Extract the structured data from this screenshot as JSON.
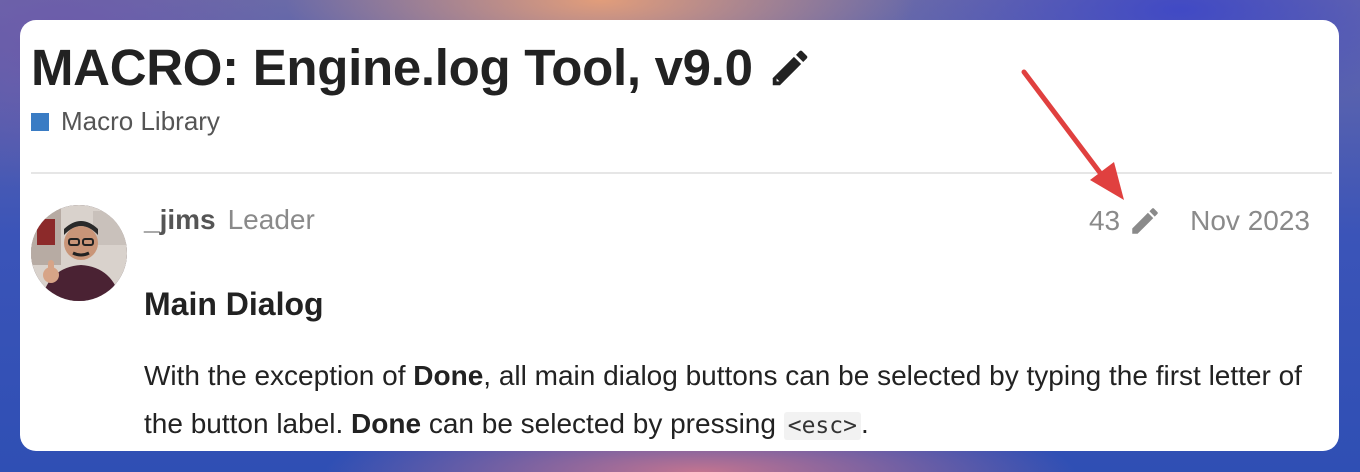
{
  "topic": {
    "title": "MACRO: Engine.log Tool, v9.0",
    "category": "Macro Library",
    "category_color": "#3a7cc4"
  },
  "post": {
    "username": "_jims",
    "user_title": "Leader",
    "edit_count": "43",
    "date": "Nov 2023",
    "heading": "Main Dialog",
    "body": {
      "p1_a": "With the exception of ",
      "p1_bold1": "Done",
      "p1_b": ", all main dialog buttons can be selected by typing the first letter of the button label. ",
      "p1_bold2": "Done",
      "p1_c": " can be selected by pressing ",
      "p1_code": "<esc>",
      "p1_d": "."
    }
  },
  "icons": {
    "title_edit": "pencil-icon",
    "post_edit": "pencil-icon"
  },
  "annotation": {
    "arrow_color": "#e0403f"
  }
}
